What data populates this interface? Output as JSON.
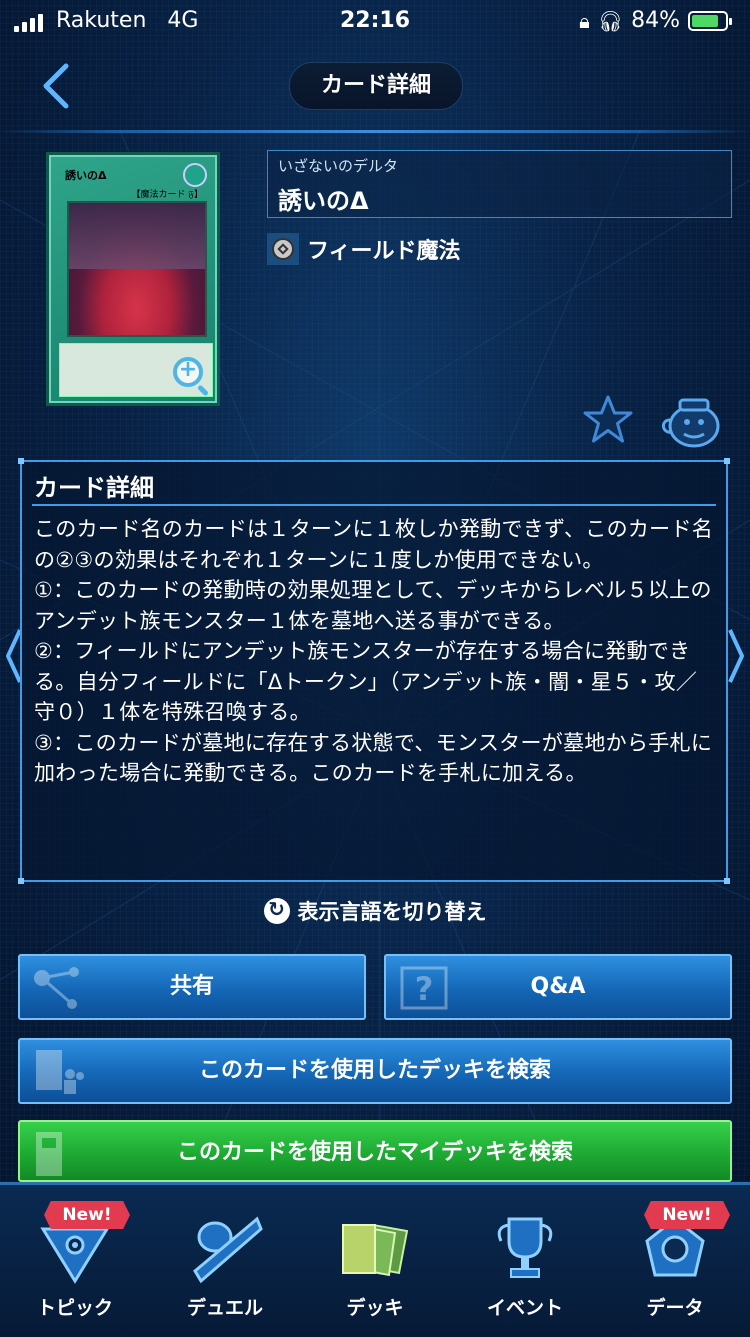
{
  "status_bar": {
    "carrier": "Rakuten",
    "network": "4G",
    "time": "22:16",
    "battery": "84%"
  },
  "header": {
    "title": "カード詳細"
  },
  "card": {
    "ruby": "いざないのデルタ",
    "name": "誘いのΔ",
    "card_type": "フィールド魔法",
    "art_title": "誘いのΔ",
    "art_type_line": "【魔法カード 𝔉】"
  },
  "detail": {
    "heading": "カード詳細",
    "text": "このカード名のカードは１ターンに１枚しか発動できず、このカード名の②③の効果はそれぞれ１ターンに１度しか使用できない。\n①：このカードの発動時の効果処理として、デッキからレベル５以上のアンデット族モンスター１体を墓地へ送る事ができる。\n②：フィールドにアンデット族モンスターが存在する場合に発動できる。自分フィールドに「Δトークン」（アンデット族・闇・星５・攻／守０）１体を特殊召喚する。\n③：このカードが墓地に存在する状態で、モンスターが墓地から手札に加わった場合に発動できる。このカードを手札に加える。"
  },
  "language_toggle": "表示言語を切り替え",
  "buttons": {
    "share": "共有",
    "qa": "Q&A",
    "search_decks": "このカードを使用したデッキを検索",
    "search_my_decks": "このカードを使用したマイデッキを検索"
  },
  "tabs": [
    {
      "label": "トピック",
      "badge": "New!"
    },
    {
      "label": "デュエル",
      "badge": ""
    },
    {
      "label": "デッキ",
      "badge": ""
    },
    {
      "label": "イベント",
      "badge": ""
    },
    {
      "label": "データ",
      "badge": "New!"
    }
  ],
  "colors": {
    "accent_blue": "#1467b6",
    "accent_green": "#1eaa34",
    "badge_red": "#e23b4f",
    "panel_border": "#3f9ce8"
  }
}
